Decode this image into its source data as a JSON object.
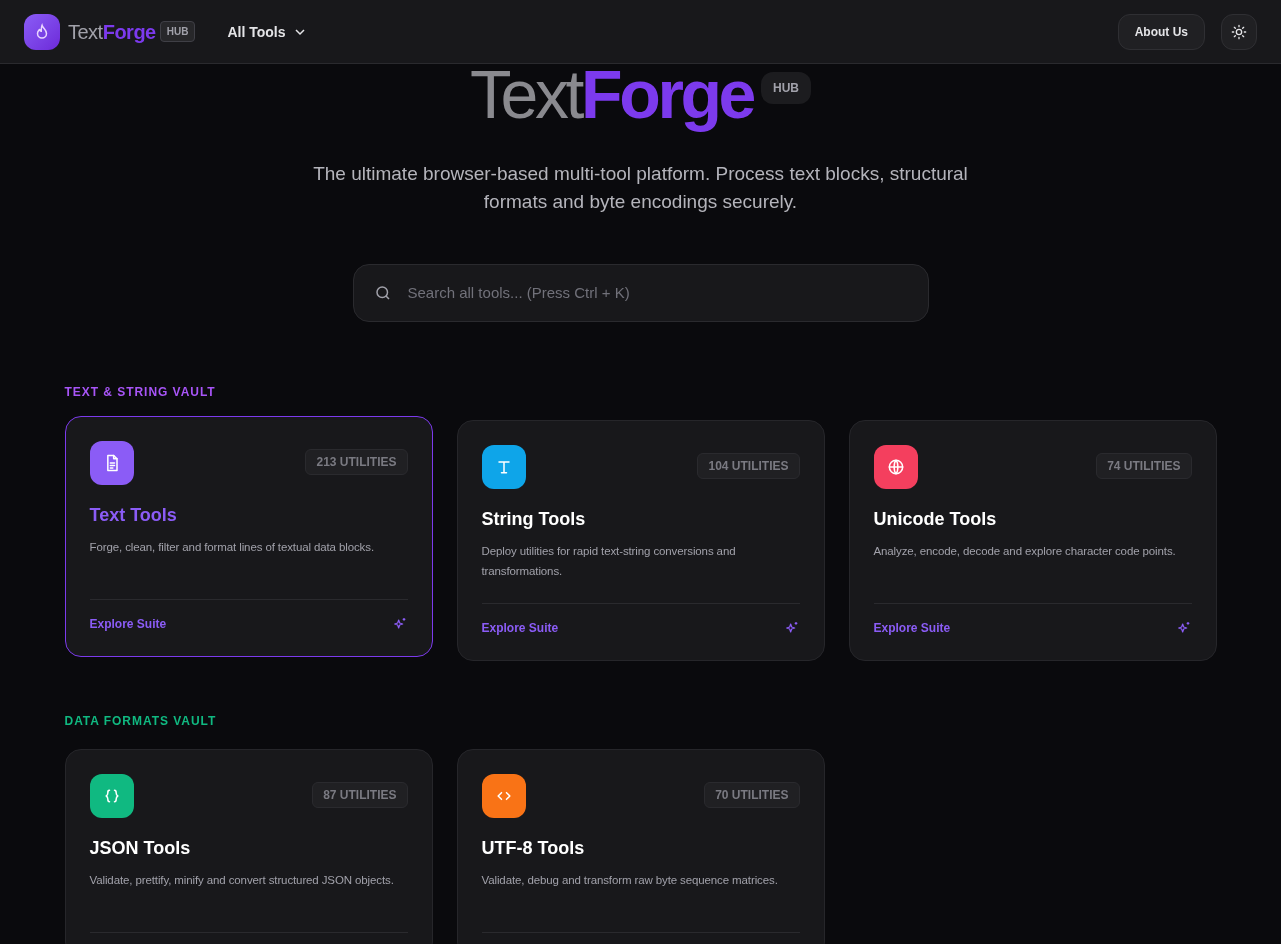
{
  "header": {
    "logo_light": "Text",
    "logo_bold": "Forge",
    "logo_badge": "HUB",
    "menu": "All Tools",
    "about": "About Us"
  },
  "hero": {
    "title_light": "Text",
    "title_bold": "Forge",
    "badge": "HUB",
    "subtitle": "The ultimate browser-based multi-tool platform. Process text blocks, structural formats and byte encodings securely."
  },
  "search": {
    "placeholder": "Search all tools... (Press Ctrl + K)"
  },
  "sections": [
    {
      "title": "TEXT & STRING VAULT",
      "color": "#a855f7",
      "cards": [
        {
          "kind": "document",
          "color": "#8b5cf6",
          "count": "213 UTILITIES",
          "title": "Text Tools",
          "description": "Forge, clean, filter and format lines of textual data blocks.",
          "link": "Explore Suite",
          "selected": true
        },
        {
          "kind": "type",
          "color": "#0ea5e9",
          "count": "104 UTILITIES",
          "title": "String Tools",
          "description": "Deploy utilities for rapid text-string conversions and transformations.",
          "link": "Explore Suite",
          "selected": false
        },
        {
          "kind": "globe",
          "color": "#f43f5e",
          "count": "74 UTILITIES",
          "title": "Unicode Tools",
          "description": "Analyze, encode, decode and explore character code points.",
          "link": "Explore Suite",
          "selected": false
        }
      ]
    },
    {
      "title": "DATA FORMATS VAULT",
      "color": "#10b981",
      "cards": [
        {
          "kind": "braces",
          "color": "#10b981",
          "count": "87 UTILITIES",
          "title": "JSON Tools",
          "description": "Validate, prettify, minify and convert structured JSON objects.",
          "selected": false
        },
        {
          "kind": "code",
          "color": "#f97316",
          "count": "70 UTILITIES",
          "title": "UTF-8 Tools",
          "description": "Validate, debug and transform raw byte sequence matrices.",
          "selected": false
        }
      ]
    }
  ]
}
